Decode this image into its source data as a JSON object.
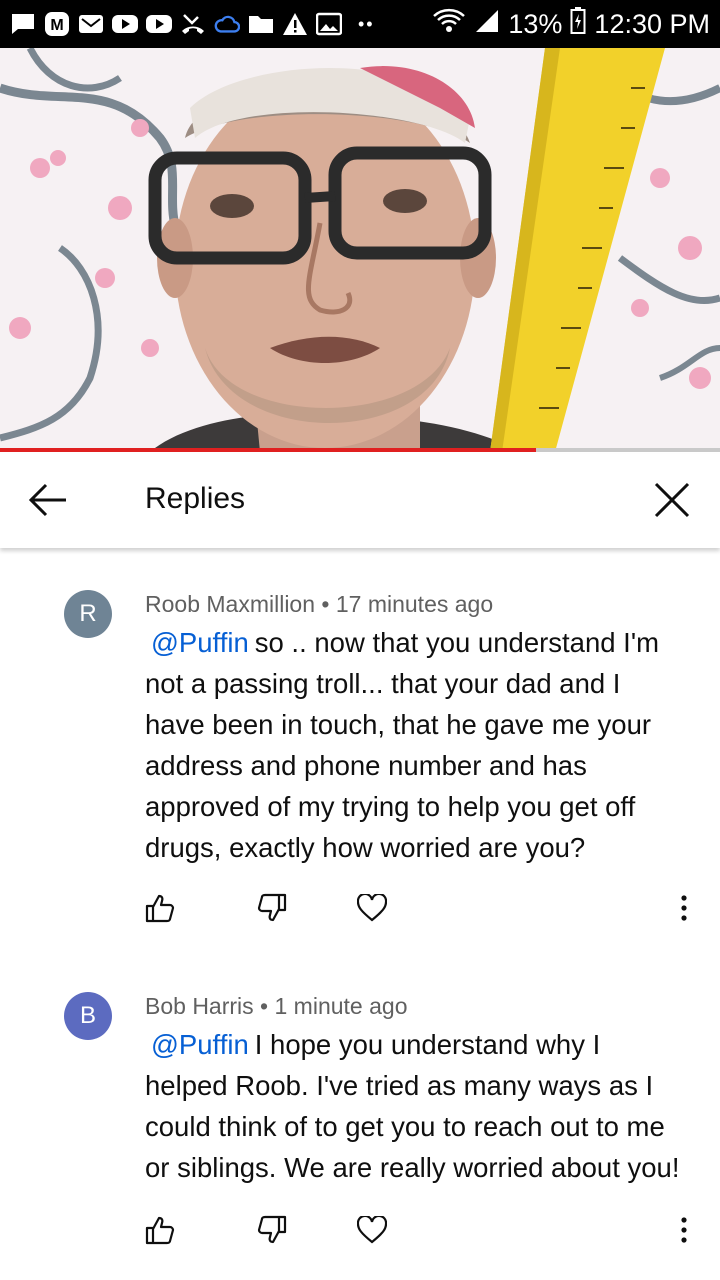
{
  "status_bar": {
    "battery": "13%",
    "time": "12:30 PM",
    "dots": "••",
    "icons": [
      "message-icon",
      "m-app-icon",
      "mail-icon",
      "youtube-icon",
      "youtube-icon",
      "missed-call-icon",
      "cloud-icon",
      "folder-icon",
      "warning-icon",
      "image-icon",
      "wifi-icon",
      "signal-icon",
      "battery-icon"
    ]
  },
  "video": {
    "progress": 0.745,
    "colors": {
      "progress": "#e02020",
      "track": "#c9c9c9"
    }
  },
  "header": {
    "title": "Replies",
    "back_icon": "arrow-left-icon",
    "close_icon": "close-icon"
  },
  "comments": [
    {
      "avatar_letter": "R",
      "avatar_color": "#6f8495",
      "author": "Roob Maxmillion",
      "separator": "•",
      "time": "17 minutes ago",
      "mention": "@Puffin",
      "lines": [
        "so .. now that you understand I'm",
        "not a passing troll... that your dad and I",
        "have been in touch, that he gave me your",
        "address and phone number and has",
        "approved of my trying to help you get off",
        "drugs, exactly how worried are you?"
      ]
    },
    {
      "avatar_letter": "B",
      "avatar_color": "#5c6bc0",
      "author": "Bob Harris",
      "separator": "•",
      "time": "1 minute ago",
      "mention": "@Puffin",
      "lines": [
        "I hope you understand why I",
        "helped Roob. I've tried as many ways as I",
        "could think of to get you to reach out to me",
        "or siblings.  We are really worried about you!"
      ]
    }
  ],
  "action_icons": [
    "thumb-up-icon",
    "thumb-down-icon",
    "heart-icon",
    "more-vert-icon"
  ]
}
